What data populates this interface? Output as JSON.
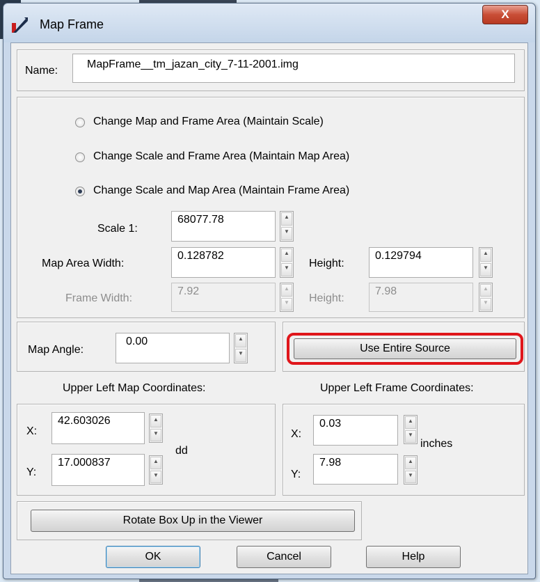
{
  "window": {
    "title": "Map Frame",
    "close_label": "X"
  },
  "name": {
    "label": "Name:",
    "value": "MapFrame__tm_jazan_city_7-11-2001.img"
  },
  "options": [
    {
      "label": "Change Map and Frame Area (Maintain Scale)",
      "selected": false
    },
    {
      "label": "Change Scale and Frame Area (Maintain Map Area)",
      "selected": false
    },
    {
      "label": "Change Scale and Map Area (Maintain Frame Area)",
      "selected": true
    }
  ],
  "scale": {
    "label": "Scale 1:",
    "value": "68077.78"
  },
  "map_area": {
    "width_label": "Map Area Width:",
    "width_value": "0.128782",
    "height_label": "Height:",
    "height_value": "0.129794"
  },
  "frame": {
    "width_label": "Frame Width:",
    "width_value": "7.92",
    "height_label": "Height:",
    "height_value": "7.98"
  },
  "angle": {
    "label": "Map Angle:",
    "value": "0.00"
  },
  "use_source_label": "Use Entire Source",
  "map_coords": {
    "title": "Upper Left Map Coordinates:",
    "x_label": "X:",
    "x_value": "42.603026",
    "y_label": "Y:",
    "y_value": "17.000837",
    "unit": "dd"
  },
  "frame_coords": {
    "title": "Upper Left Frame Coordinates:",
    "x_label": "X:",
    "x_value": "0.03",
    "y_label": "Y:",
    "y_value": "7.98",
    "unit": "inches"
  },
  "rotate_label": "Rotate Box Up in the Viewer",
  "buttons": {
    "ok": "OK",
    "cancel": "Cancel",
    "help": "Help"
  },
  "colors": {
    "highlight": "#e0161b",
    "close": "#c94e36"
  }
}
